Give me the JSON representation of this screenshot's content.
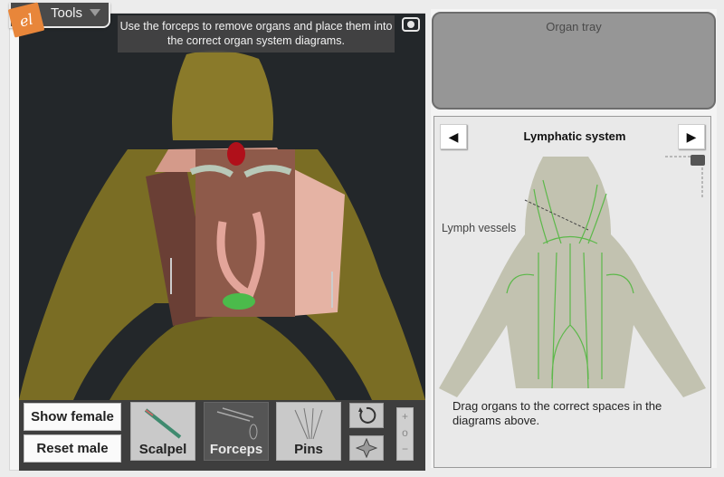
{
  "tools_menu": {
    "label": "Tools",
    "logo_text": "el",
    "logo_color": "#e8863a"
  },
  "instruction": "Use the forceps to remove organs and place them into the correct organ system diagrams.",
  "left_camera_icon": "camera-icon",
  "buttons": {
    "show_female": "Show female",
    "reset_male": "Reset male"
  },
  "tools": [
    {
      "label": "Scalpel",
      "icon": "scalpel-icon",
      "active": false
    },
    {
      "label": "Forceps",
      "icon": "forceps-icon",
      "active": true
    },
    {
      "label": "Pins",
      "icon": "pins-icon",
      "active": false
    }
  ],
  "view_controls": {
    "rotate_icon": "rotate-icon",
    "pan_icon": "pan-icon"
  },
  "zoom_controls": {
    "plus": "+",
    "reset": "o",
    "minus": "−"
  },
  "organ_tray": {
    "title": "Organ tray"
  },
  "diagram": {
    "title": "Lymphatic system",
    "prev_label": "◀",
    "next_label": "▶",
    "label": "Lymph vessels",
    "instructions": "Drag organs to the correct spaces in the diagrams above.",
    "camera_icon": "camera-icon"
  },
  "colors": {
    "viewport_bg": "#23272a",
    "tray": "#969696",
    "lymph_green": "#5cb84a",
    "frog_skin": "#8a7a2e"
  }
}
